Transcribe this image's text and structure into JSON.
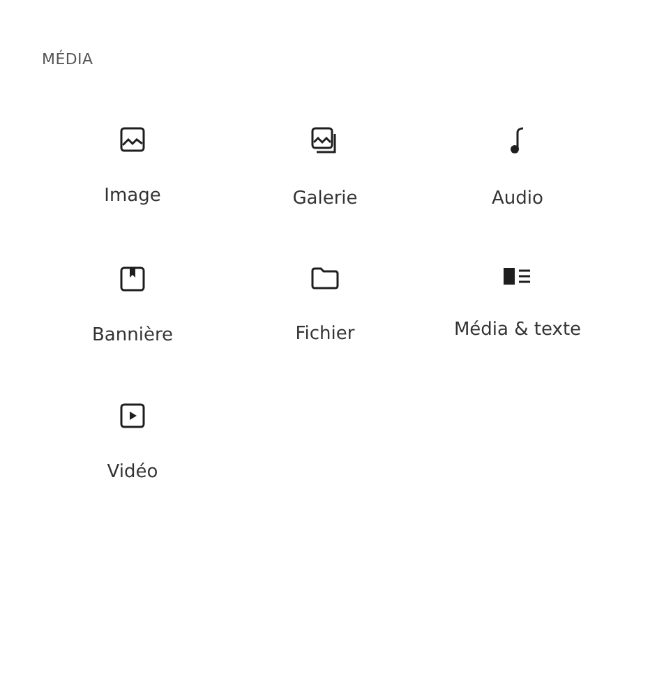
{
  "section": {
    "title": "MÉDIA"
  },
  "blocks": [
    {
      "kind": "image",
      "label": "Image"
    },
    {
      "kind": "gallery",
      "label": "Galerie"
    },
    {
      "kind": "audio",
      "label": "Audio"
    },
    {
      "kind": "cover",
      "label": "Bannière"
    },
    {
      "kind": "file",
      "label": "Fichier"
    },
    {
      "kind": "media-text",
      "label": "Média & texte"
    },
    {
      "kind": "video",
      "label": "Vidéo"
    }
  ]
}
